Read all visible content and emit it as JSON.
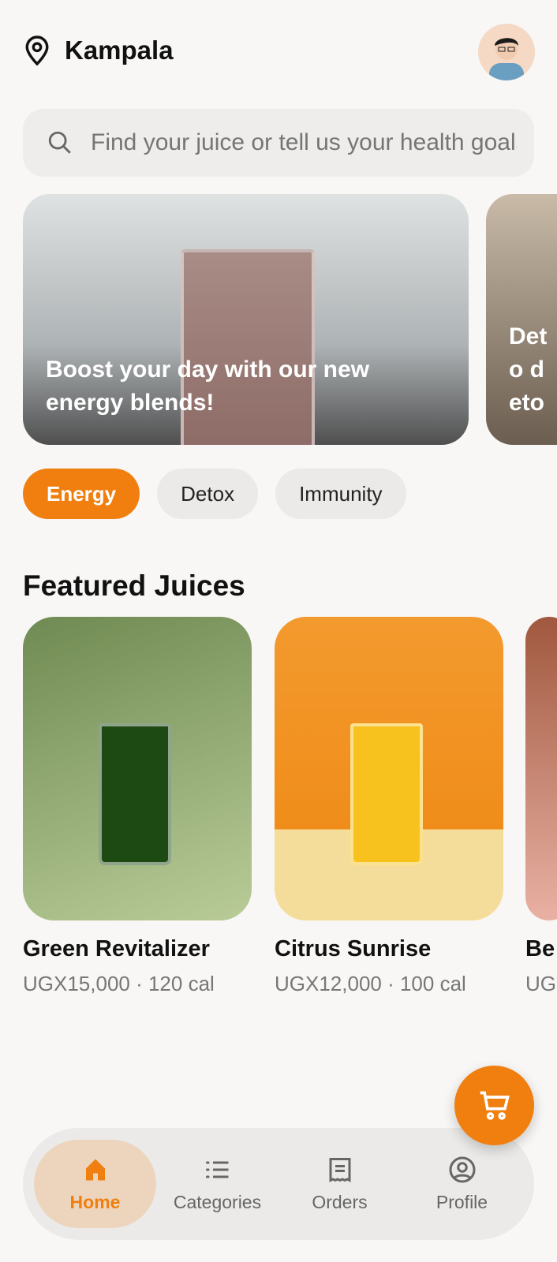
{
  "header": {
    "location": "Kampala"
  },
  "search": {
    "placeholder": "Find your juice or tell us your health goals"
  },
  "banners": [
    {
      "text": "Boost your day with our new energy blends!"
    },
    {
      "text": "Deto deto"
    }
  ],
  "chips": [
    {
      "label": "Energy",
      "active": true
    },
    {
      "label": "Detox"
    },
    {
      "label": "Immunity"
    }
  ],
  "featured": {
    "title": "Featured Juices",
    "items": [
      {
        "name": "Green Revitalizer",
        "meta": "UGX15,000 · 120 cal"
      },
      {
        "name": "Citrus Sunrise",
        "meta": "UGX12,000 · 100 cal"
      },
      {
        "name": "Be",
        "meta": "UG"
      }
    ]
  },
  "nav": [
    {
      "label": "Home",
      "active": true
    },
    {
      "label": "Categories"
    },
    {
      "label": "Orders"
    },
    {
      "label": "Profile"
    }
  ],
  "colors": {
    "accent": "#f07f10"
  }
}
